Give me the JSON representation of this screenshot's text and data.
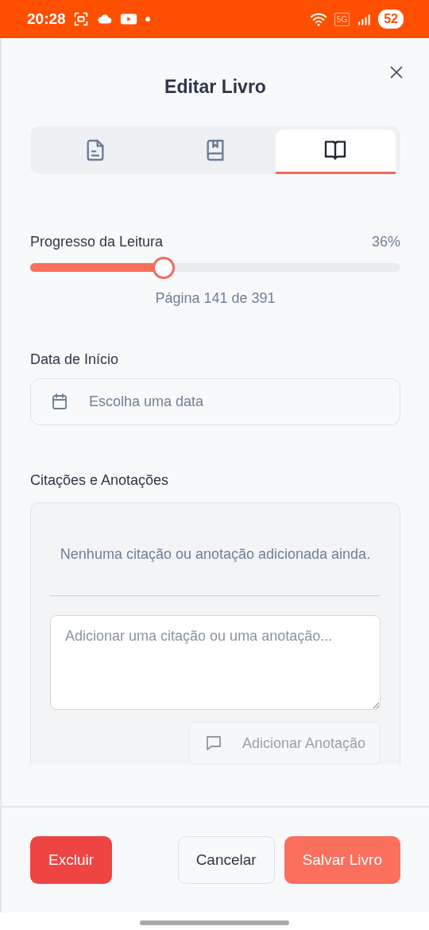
{
  "status_bar": {
    "time": "20:28",
    "network": "5G",
    "battery": "52"
  },
  "dialog": {
    "title": "Editar Livro"
  },
  "tabs": [
    {
      "kind": "document",
      "selected": false
    },
    {
      "kind": "book",
      "selected": false
    },
    {
      "kind": "reading",
      "selected": true
    }
  ],
  "progress": {
    "label": "Progresso da Leitura",
    "percent": "36%",
    "level": 0.36,
    "pages": "Página 141 de 391"
  },
  "start_date": {
    "label": "Data de Início",
    "placeholder": "Escolha uma data"
  },
  "notes": {
    "label": "Citações e Anotações",
    "empty_message": "Nenhuma citação ou anotação adicionada ainda.",
    "input_placeholder": "Adicionar uma citação ou uma anotação...",
    "add_button": {
      "label": "Adicionar Anotação",
      "disabled": true
    }
  },
  "buttons": [
    {
      "kind": "danger",
      "label": "Excluir"
    },
    {
      "kind": "secondary",
      "label": "Cancelar"
    },
    {
      "kind": "primary",
      "label": "Salvar Livro"
    }
  ]
}
